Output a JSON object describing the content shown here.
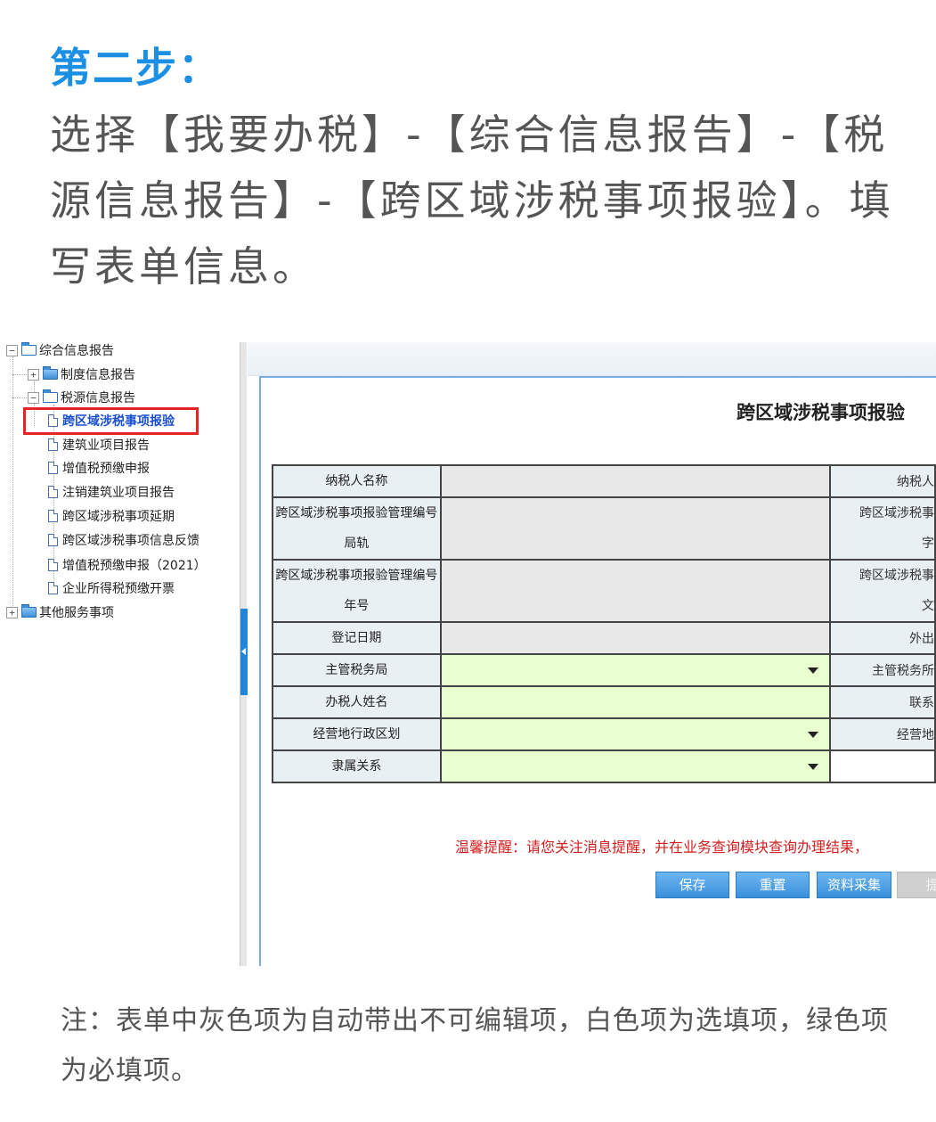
{
  "article": {
    "step_title": "第二步：",
    "step_desc": "选择【我要办税】-【综合信息报告】-【税源信息报告】-【跨区域涉税事项报验】。填写表单信息。",
    "note": "注：表单中灰色项为自动带出不可编辑项，白色项为选填项，绿色项为必填项。"
  },
  "tree": {
    "root": "综合信息报告",
    "child1": "制度信息报告",
    "child2": "税源信息报告",
    "items": [
      "跨区域涉税事项报验",
      "建筑业项目报告",
      "增值税预缴申报",
      "注销建筑业项目报告",
      "跨区域涉税事项延期",
      "跨区域涉税事项信息反馈",
      "增值税预缴申报（2021）",
      "企业所得税预缴开票"
    ],
    "other": "其他服务事项"
  },
  "form": {
    "title": "跨区域涉税事项报验",
    "rows": [
      {
        "label": "纳税人名称",
        "right": "纳税人"
      },
      {
        "label": "跨区域涉税事项报验管理编号局轨",
        "label_line1": "跨区域涉税事项报验管理编号",
        "label_line2": "局轨",
        "right_line1": "跨区域涉税事",
        "right_line2": "字"
      },
      {
        "label": "跨区域涉税事项报验管理编号年号",
        "label_line1": "跨区域涉税事项报验管理编号",
        "label_line2": "年号",
        "right_line1": "跨区域涉税事",
        "right_line2": "文"
      },
      {
        "label": "登记日期",
        "right": "外出"
      },
      {
        "label": "主管税务局",
        "right": "主管税务所"
      },
      {
        "label": "办税人姓名",
        "right": "联系"
      },
      {
        "label": "经营地行政区划",
        "right": "经营地"
      },
      {
        "label": "隶属关系",
        "right": ""
      }
    ],
    "reminder": "温馨提醒：请您关注消息提醒，并在业务查询模块查询办理结果，",
    "buttons": {
      "save": "保存",
      "reset": "重置",
      "collect": "资料采集",
      "submit": "提"
    }
  },
  "colors": {
    "accent": "#1a8fe3",
    "required_field": "#eaffcf",
    "auto_field": "#e8e8e8",
    "highlight_box": "#e52424",
    "reminder": "#d11f1f"
  },
  "icons": [
    "folder-icon",
    "document-icon",
    "expand-toggle-icon",
    "collapse-toggle-icon",
    "dropdown-arrow-icon",
    "collapse-panel-icon"
  ]
}
